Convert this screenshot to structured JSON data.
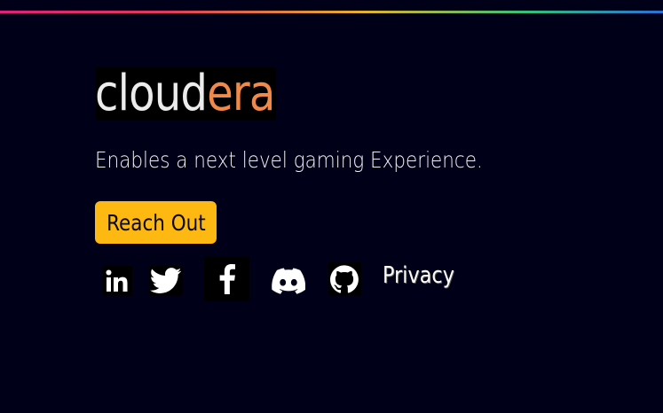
{
  "brand": {
    "logo_part_a": "cloud",
    "logo_part_b": "era",
    "tagline": "Enables a next level gaming Experience."
  },
  "cta": {
    "label": "Reach Out"
  },
  "socials": [
    {
      "name": "LinkedIn",
      "icon": "linkedin-icon"
    },
    {
      "name": "Twitter",
      "icon": "twitter-icon"
    },
    {
      "name": "Facebook",
      "icon": "facebook-icon"
    },
    {
      "name": "Discord",
      "icon": "discord-icon"
    },
    {
      "name": "GitHub",
      "icon": "github-icon"
    }
  ],
  "links": {
    "privacy": "Privacy"
  },
  "colors": {
    "background": "#000019",
    "accent": "#fdb812",
    "logo_highlight": "#f08a4a",
    "gradient": [
      "#e0207a",
      "#e6b22a",
      "#2ec27a",
      "#2a6fd8"
    ]
  }
}
